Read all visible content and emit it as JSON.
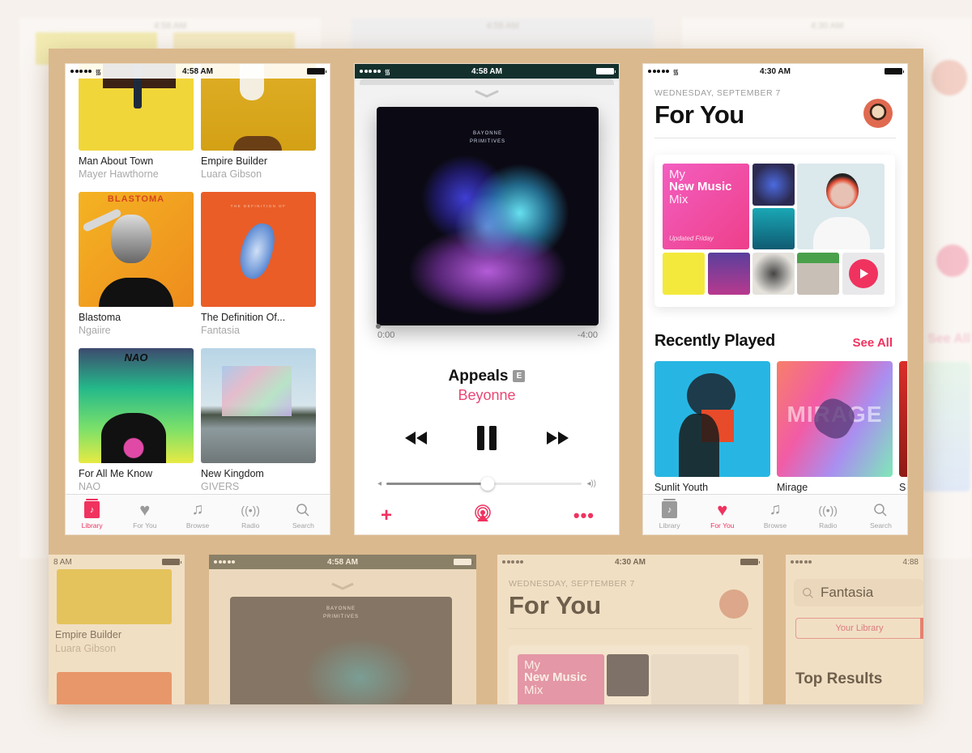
{
  "background_frames": {
    "left_time": "4:58 AM",
    "middle_time": "4:58 AM",
    "right_time": "4:30 AM",
    "right_see_all": "See All"
  },
  "library_screen": {
    "status": {
      "time": "4:58 AM"
    },
    "albums": [
      {
        "title": "Man About Town",
        "artist": "Mayer Hawthorne",
        "art": "yellow-figure"
      },
      {
        "title": "Empire Builder",
        "artist": "Luara Gibson",
        "art": "yellow-portrait"
      },
      {
        "title": "Blastoma",
        "artist": "Ngaiire",
        "art": "orange-blastoma",
        "cover_text": "BLASTOMA"
      },
      {
        "title": "The Definition Of...",
        "artist": "Fantasia",
        "art": "orange-mask",
        "cover_text": "THE DEFINITION OF"
      },
      {
        "title": "For All Me Know",
        "artist": "NAO",
        "art": "gradient-nao",
        "cover_text": "NAO"
      },
      {
        "title": "New Kingdom",
        "artist": "GIVERS",
        "art": "cube-lake"
      }
    ],
    "tabbar": {
      "active": "Library",
      "tabs": [
        {
          "label": "Library",
          "icon": "library-icon"
        },
        {
          "label": "For You",
          "icon": "heart-icon"
        },
        {
          "label": "Browse",
          "icon": "music-note-icon"
        },
        {
          "label": "Radio",
          "icon": "radio-icon"
        },
        {
          "label": "Search",
          "icon": "search-icon"
        }
      ]
    }
  },
  "now_playing_screen": {
    "status": {
      "time": "4:58 AM"
    },
    "cover_text": [
      "BAYONNE",
      "PRIMITIVES"
    ],
    "elapsed": "0:00",
    "remaining": "-4:00",
    "progress_fraction": 0.0,
    "track_title": "Appeals",
    "explicit_badge": "E",
    "artist": "Beyonne",
    "volume_fraction": 0.52,
    "controls": {
      "rewind": "rewind-icon",
      "play_pause": "pause-icon",
      "fast_forward": "fast-forward-icon"
    },
    "actions": {
      "add": "+",
      "airplay": "airplay-icon",
      "more": "•••"
    }
  },
  "for_you_screen": {
    "status": {
      "time": "4:30 AM"
    },
    "date": "WEDNESDAY, SEPTEMBER 7",
    "title": "For You",
    "mix": {
      "line1": "My",
      "line2": "New Music",
      "line3": "Mix",
      "updated": "Updated Friday"
    },
    "recently_played": {
      "heading": "Recently Played",
      "see_all": "See All",
      "items": [
        {
          "title": "Sunlit Youth"
        },
        {
          "title": "Mirage",
          "cover_text": "MIRAGE"
        },
        {
          "title": "S"
        }
      ]
    },
    "tabbar": {
      "active": "For You",
      "tabs": [
        {
          "label": "Library"
        },
        {
          "label": "For You"
        },
        {
          "label": "Browse"
        },
        {
          "label": "Radio"
        },
        {
          "label": "Search"
        }
      ]
    }
  },
  "lower_row": {
    "library": {
      "time": "8 AM",
      "album_title": "Empire Builder",
      "album_artist": "Luara Gibson"
    },
    "now_playing": {
      "time": "4:58 AM",
      "cover_text": [
        "BAYONNE",
        "PRIMITIVES"
      ]
    },
    "for_you": {
      "time": "4:30 AM",
      "date": "WEDNESDAY, SEPTEMBER 7",
      "title": "For You",
      "mix_line1": "My",
      "mix_line2": "New Music",
      "mix_line3": "Mix"
    },
    "search": {
      "time": "4:88",
      "query": "Fantasia",
      "scope_button": "Your Library",
      "top_results": "Top Results"
    }
  },
  "colors": {
    "accent": "#f0325f",
    "board": "#dbb98e",
    "page_background": "#f6f1ec"
  }
}
